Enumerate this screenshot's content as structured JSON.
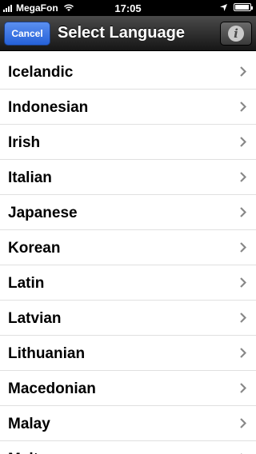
{
  "status_bar": {
    "carrier": "MegaFon",
    "time": "17:05"
  },
  "nav": {
    "cancel_label": "Cancel",
    "title": "Select Language",
    "info_glyph": "i"
  },
  "languages": [
    {
      "label": "Icelandic"
    },
    {
      "label": "Indonesian"
    },
    {
      "label": "Irish"
    },
    {
      "label": "Italian"
    },
    {
      "label": "Japanese"
    },
    {
      "label": "Korean"
    },
    {
      "label": "Latin"
    },
    {
      "label": "Latvian"
    },
    {
      "label": "Lithuanian"
    },
    {
      "label": "Macedonian"
    },
    {
      "label": "Malay"
    },
    {
      "label": "Maltese"
    }
  ],
  "icons": {
    "signal": "signal-bars-icon",
    "wifi": "wifi-icon",
    "location": "location-arrow-icon",
    "battery": "battery-icon",
    "chevron": "chevron-right-icon",
    "info": "info-icon"
  },
  "colors": {
    "nav_bar": "#2a2a2a",
    "cancel_button": "#3a74e5",
    "chevron": "#888888",
    "separator": "#e0e0e0"
  }
}
